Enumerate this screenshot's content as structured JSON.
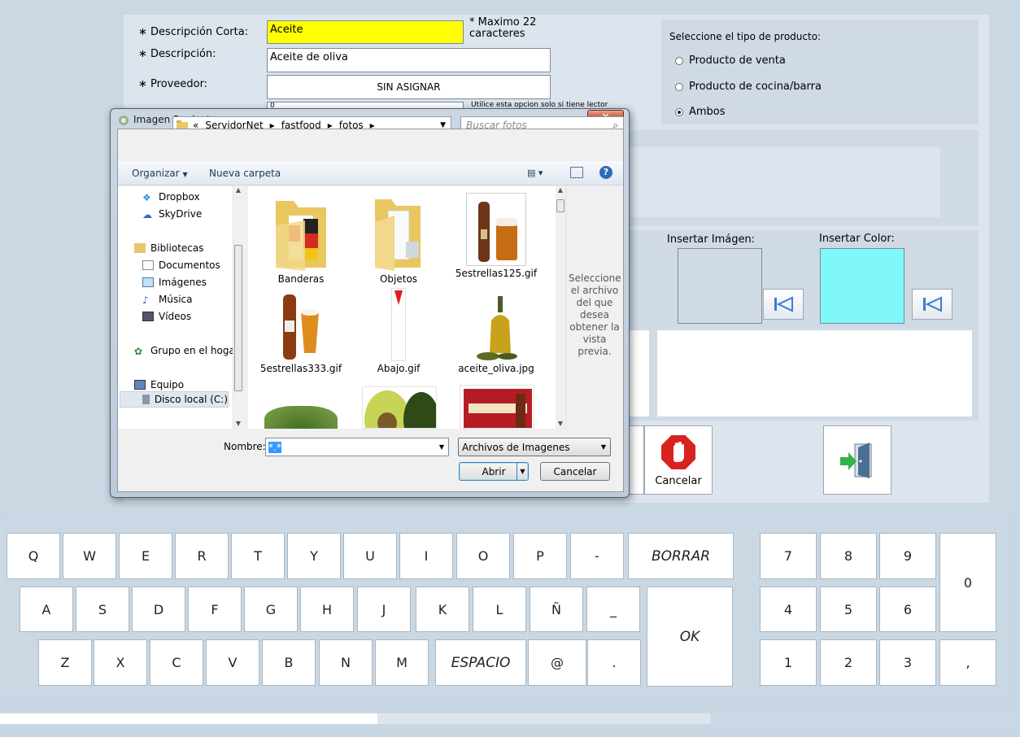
{
  "form": {
    "short_desc_label": "Descripción Corta:",
    "short_desc_value": "Aceite",
    "max_note": "* Maximo 22 caracteres",
    "desc_label": "Descripción:",
    "desc_value": "Aceite de oliva",
    "supplier_label": "Proveedor:",
    "supplier_value": "SIN ASIGNAR",
    "barcode_value": "0",
    "barcode_note": "Utilice esta opcion solo si tiene lector",
    "required_mark": "∗",
    "short_desc_bg": "#ffff00"
  },
  "product_type": {
    "title": "Seleccione el tipo de producto:",
    "options": [
      {
        "label": "Producto de venta",
        "selected": false
      },
      {
        "label": "Producto de cocina/barra",
        "selected": false
      },
      {
        "label": "Ambos",
        "selected": true
      }
    ]
  },
  "media": {
    "image_label": "Insertar Imágen:",
    "color_label": "Insertar Color:",
    "color_value": "#7ff7fb"
  },
  "actions": {
    "cancel_label": "Cancelar"
  },
  "keyboard": {
    "row1": [
      "Q",
      "W",
      "E",
      "R",
      "T",
      "Y",
      "U",
      "I",
      "O",
      "P",
      "-"
    ],
    "row2": [
      "A",
      "S",
      "D",
      "F",
      "G",
      "H",
      "J",
      "K",
      "L",
      "Ñ",
      "_"
    ],
    "row3": [
      "Z",
      "X",
      "C",
      "V",
      "B",
      "N",
      "M",
      "ESPACIO",
      "@",
      "."
    ],
    "borrar": "BORRAR",
    "ok": "OK",
    "numpad": [
      "7",
      "8",
      "9",
      "4",
      "5",
      "6",
      "1",
      "2",
      "3",
      "0",
      ","
    ]
  },
  "dialog": {
    "title": "Imagen Producto",
    "close": "✕",
    "breadcrumb": [
      "«",
      "ServidorNet",
      "fastfood",
      "fotos"
    ],
    "search_placeholder": "Buscar fotos",
    "organize": "Organizar",
    "new_folder": "Nueva carpeta",
    "nav": [
      "Dropbox",
      "SkyDrive",
      "Bibliotecas",
      "Documentos",
      "Imágenes",
      "Música",
      "Vídeos",
      "Grupo en el hogar",
      "Equipo",
      "Disco local (C:)"
    ],
    "files": [
      "Banderas",
      "Objetos",
      "5estrellas125.gif",
      "5estrellas333.gif",
      "Abajo.gif",
      "aceite_oliva.jpg"
    ],
    "preview_text": "Seleccione el archivo del que desea obtener la vista previa.",
    "name_label": "Nombre:",
    "name_value": "*.*",
    "filter_value": "Archivos de Imagenes",
    "open_label": "Abrir",
    "cancel_label": "Cancelar"
  }
}
